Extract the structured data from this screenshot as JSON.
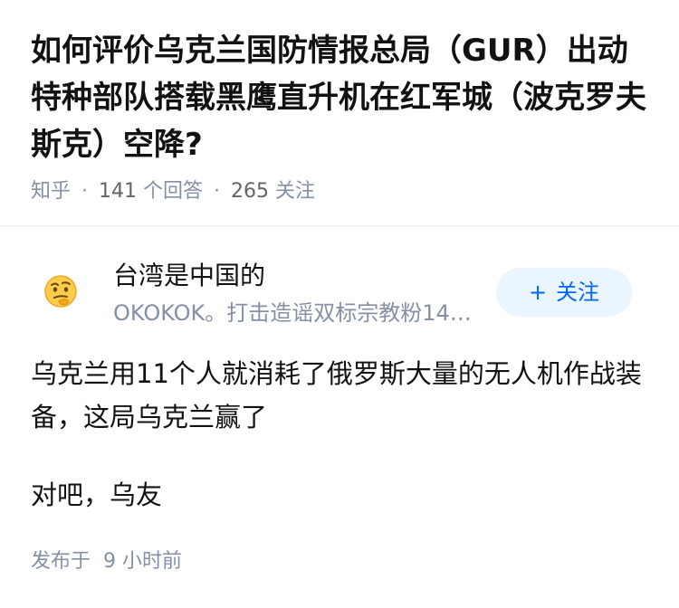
{
  "question": {
    "title": "如何评价乌克兰国防情报总局（GUR）出动特种部队搭载黑鹰直升机在红军城（波克罗夫斯克）空降?",
    "source": "知乎",
    "answers_count": "141",
    "answers_label": "个回答",
    "followers_count": "265",
    "followers_label": "关注",
    "separator": "·"
  },
  "answer": {
    "author": {
      "name": "台湾是中国的",
      "bio": "OKOKOK。打击造谣双标宗教粉14…",
      "avatar_icon": "thinking-face-emoji"
    },
    "follow_button": {
      "plus": "+",
      "label": "关注"
    },
    "paragraphs": [
      "乌克兰用11个人就消耗了俄罗斯大量的无人机作战装备，这局乌克兰赢了",
      "对吧，乌友"
    ],
    "time_prefix": "发布于",
    "time_value": "9 小时前"
  },
  "colors": {
    "accent": "#0066ff",
    "accent_bg": "#ebf5ff",
    "muted": "#8590a6",
    "text": "#121212"
  }
}
